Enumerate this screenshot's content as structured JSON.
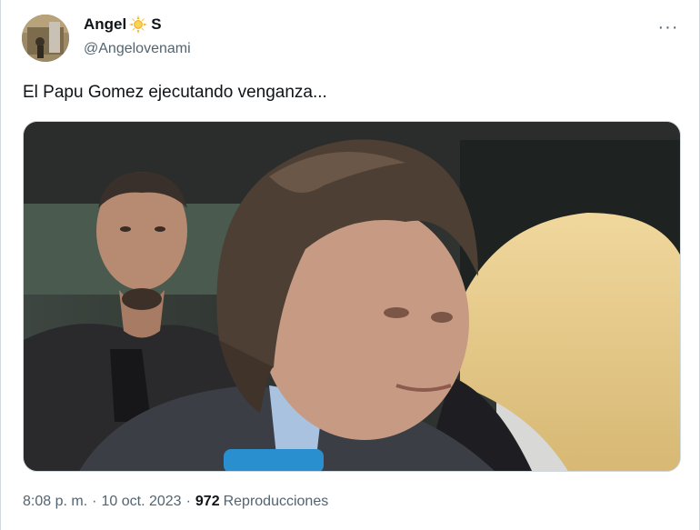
{
  "tweet": {
    "display_name": "Angel",
    "display_name_suffix": "S",
    "handle": "@Angelovenami",
    "text": "El Papu Gomez ejecutando venganza...",
    "more_label": "···",
    "time": "8:08 p. m.",
    "separator": "·",
    "date": "10 oct. 2023",
    "views_count": "972",
    "views_label": "Reproducciones"
  },
  "icons": {
    "name_emoji": "sun-icon",
    "more": "more-horizontal-icon"
  },
  "colors": {
    "primary_text": "#0f1419",
    "secondary_text": "#536471",
    "border": "#cfd9de",
    "sun": "#f5b82e"
  }
}
